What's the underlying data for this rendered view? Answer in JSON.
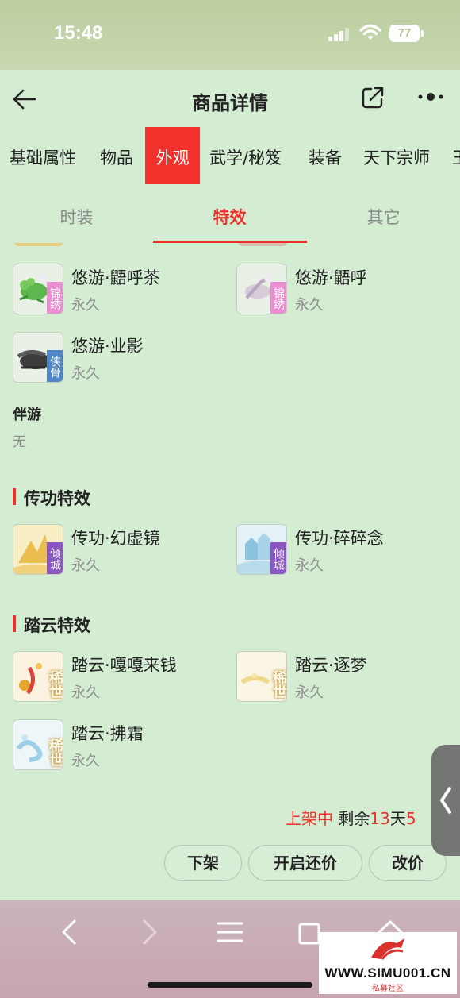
{
  "status_bar": {
    "time": "15:48",
    "battery": "77"
  },
  "header": {
    "title": "商品详情"
  },
  "main_tabs": [
    "基础属性",
    "物品",
    "外观",
    "武学/秘笈",
    "装备",
    "天下宗师",
    "王"
  ],
  "sub_tabs": [
    "时装",
    "特效",
    "其它"
  ],
  "mount_items": [
    {
      "name": "悠游·鼯呼茶",
      "duration": "永久",
      "tag": "锦绣"
    },
    {
      "name": "悠游·鼯呼",
      "duration": "永久",
      "tag": "锦绣"
    },
    {
      "name": "悠游·业影",
      "duration": "永久",
      "tag": "侠骨"
    }
  ],
  "companion": {
    "label": "伴游",
    "value": "无"
  },
  "sections": {
    "chuangong": {
      "title": "传功特效",
      "items": [
        {
          "name": "传功·幻虚镜",
          "duration": "永久",
          "tag": "倾城"
        },
        {
          "name": "传功·碎碎念",
          "duration": "永久",
          "tag": "倾城"
        }
      ]
    },
    "tayun": {
      "title": "踏云特效",
      "items": [
        {
          "name": "踏云·嘎嘎来钱",
          "duration": "永久",
          "tag": "稀世"
        },
        {
          "name": "踏云·逐梦",
          "duration": "永久",
          "tag": "稀世"
        },
        {
          "name": "踏云·拂霜",
          "duration": "永久",
          "tag": "稀世"
        }
      ]
    }
  },
  "listing": {
    "status": "上架中",
    "remaining_prefix": "剩余",
    "days": "13",
    "days_unit": "天",
    "hours_partial": "5"
  },
  "actions": {
    "delist": "下架",
    "open_bargain": "开启还价",
    "change_price": "改价"
  },
  "watermark": {
    "url": "WWW.SIMU001.CN",
    "subtitle": "私募社区"
  },
  "colors": {
    "accent": "#e8322b",
    "background": "#d4ecd2"
  }
}
